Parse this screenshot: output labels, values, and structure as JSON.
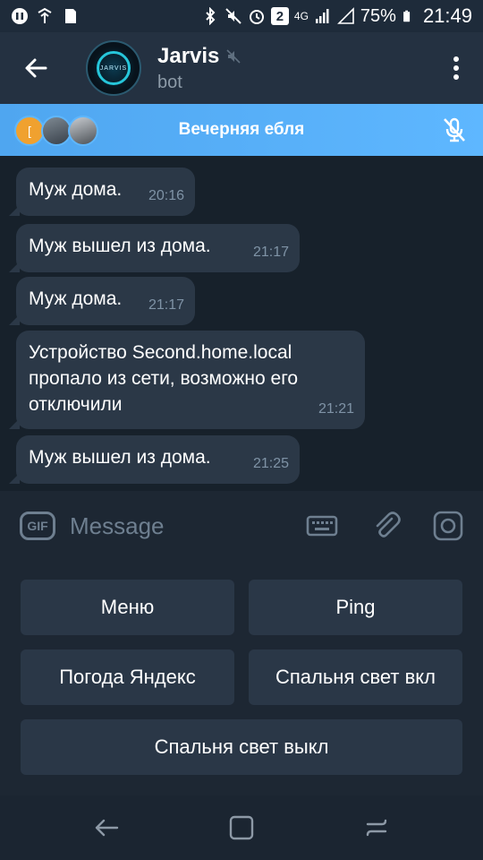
{
  "status_bar": {
    "battery": "75%",
    "time": "21:49",
    "network": "4G",
    "notif_count": "2",
    "icons_left": [
      "media-icon",
      "wifi-upload-icon",
      "sdcard-icon"
    ],
    "icons_right": [
      "bluetooth-icon",
      "mute-icon",
      "alarm-icon",
      "notification-badge-icon",
      "signal-icon",
      "battery-icon"
    ]
  },
  "header": {
    "title": "Jarvis",
    "subtitle": "bot",
    "avatar_text": "JARVIS",
    "muted": true
  },
  "voice_chat": {
    "title": "Вечерняя ебля",
    "first_avatar_letter": "[",
    "mic_muted": true
  },
  "messages": [
    {
      "text": "Муж дома.",
      "time": "20:16"
    },
    {
      "text": "Муж вышел из дома.",
      "time": "21:17"
    },
    {
      "text": "Муж дома.",
      "time": "21:17"
    },
    {
      "text": "Устройство Second.home.local пропало из сети, возможно его отключили",
      "lines": [
        "Устройство Second.home.local",
        "пропало из сети, возможно его",
        "отключили"
      ],
      "time": "21:21"
    },
    {
      "text": "Муж вышел из дома.",
      "time": "21:25"
    }
  ],
  "composer": {
    "gif_label": "GIF",
    "placeholder": "Message"
  },
  "keyboard": {
    "buttons": [
      {
        "label": "Меню"
      },
      {
        "label": "Ping"
      },
      {
        "label": "Погода Яндекс"
      },
      {
        "label": "Спальня свет вкл"
      },
      {
        "label": "Спальня свет выкл"
      }
    ]
  },
  "colors": {
    "background": "#17212b",
    "header": "#243141",
    "bubble": "#2b3847",
    "accent": "#5eb7ff",
    "muted_text": "#7f93a6"
  }
}
